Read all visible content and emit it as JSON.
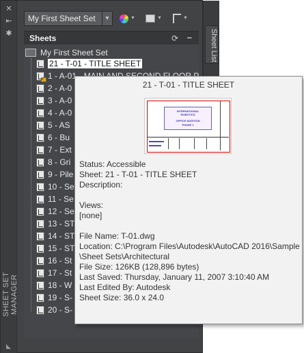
{
  "palette": {
    "vertical_title": "SHEET SET MANAGER",
    "tab_sheet_list": "Sheet List",
    "sheet_set_select": "My First Sheet Set"
  },
  "sheets_panel": {
    "title": "Sheets",
    "root": "My First Sheet Set",
    "items": [
      {
        "label": "21 - T-01 - TITLE SHEET",
        "selected": true
      },
      {
        "label": "1 - A-01 - MAIN AND SECOND FLOOR P"
      },
      {
        "label": "2 - A-0"
      },
      {
        "label": "3 - A-0"
      },
      {
        "label": "4 - A-0"
      },
      {
        "label": "5 - AS"
      },
      {
        "label": "6 - Bu"
      },
      {
        "label": "7 - Ext"
      },
      {
        "label": "8 - Gri"
      },
      {
        "label": "9 - Pile"
      },
      {
        "label": "10 - Se"
      },
      {
        "label": "11 - Se"
      },
      {
        "label": "12 - Se"
      },
      {
        "label": "13 - ST"
      },
      {
        "label": "14 - ST"
      },
      {
        "label": "15 - ST"
      },
      {
        "label": "16 - St"
      },
      {
        "label": "17 - St"
      },
      {
        "label": "18 - W"
      },
      {
        "label": "19 - S-"
      },
      {
        "label": "20 - S-"
      }
    ]
  },
  "tooltip": {
    "title": "21 - T-01 - TITLE SHEET",
    "thumb_text_1": "INTERNATIONAL",
    "thumb_text_2": "ROBOTICS",
    "thumb_text_3": "OFFICE ADDITION",
    "thumb_text_4": "PHASE 1",
    "status": "Status: Accessible",
    "sheet": "Sheet: 21 - T-01 - TITLE SHEET",
    "description": "Description:",
    "views": "Views:",
    "views_value": "[none]",
    "file_name": "File Name: T-01.dwg",
    "location_1": "Location: C:\\Program Files\\Autodesk\\AutoCAD 2016\\Sample",
    "location_2": "\\Sheet Sets\\Architectural",
    "file_size": "File Size: 126KB (128,896 bytes)",
    "last_saved": "Last Saved: Thursday, January 11, 2007  3:10:40 AM",
    "last_edited_by": "Last Edited By: Autodesk",
    "sheet_size": "Sheet Size: 36.0 x 24.0"
  }
}
